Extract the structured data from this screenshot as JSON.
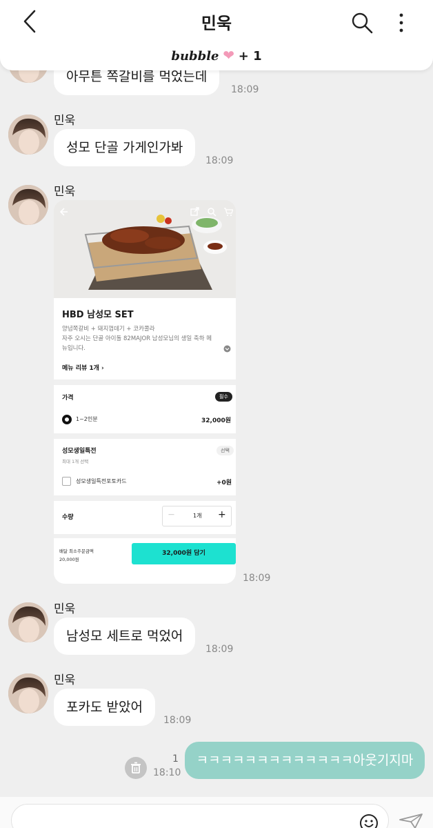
{
  "header": {
    "title": "민욱",
    "subscription": {
      "brand": "bubble",
      "count": "+ 1"
    }
  },
  "messages": {
    "m1": {
      "text": "아무튼 쪽갈비를 먹었는데",
      "time": "18:09"
    },
    "m2": {
      "sender": "민욱",
      "text": "성모 단골 가게인가봐",
      "time": "18:09"
    },
    "m3": {
      "sender": "민욱",
      "time": "18:09",
      "card": {
        "product_title": "HBD 남성모 SET",
        "desc_line1": "양념쪽갈비 + 돼지껍데기 + 코카콜라",
        "desc_line2": "자주 오시는 단골 아이돌 82MAJOR 남성모님의 생일 축하 메",
        "desc_line3": "뉴입니다.",
        "review_link": "메뉴 리뷰 1개 ›",
        "price_label": "가격",
        "price_required": "필수",
        "option_portion": "1~2인분",
        "option_price": "32,000원",
        "event_label": "성모생일특전",
        "event_optional": "선택",
        "event_max": "최대 1개 선택",
        "event_option": "성모생일특전포토카드",
        "event_price": "+0원",
        "qty_label": "수량",
        "qty_minus": "—",
        "qty_value": "1개",
        "qty_plus": "+",
        "min_order_label": "배달 최소주문금액",
        "min_order_value": "20,000원",
        "cart_button": "32,000원 담기"
      }
    },
    "m4": {
      "sender": "민욱",
      "text": "남성모 세트로 먹었어",
      "time": "18:09"
    },
    "m5": {
      "sender": "민욱",
      "text": "포카도 받았어",
      "time": "18:09"
    },
    "mine": {
      "text": "ㅋㅋㅋㅋㅋㅋㅋㅋㅋㅋㅋㅋㅋ아웃기지마",
      "time": "18:10",
      "unread": "1"
    }
  },
  "colors": {
    "accent": "#95d2c8",
    "cart": "#1de1d0",
    "heart": "#f39ab8"
  }
}
